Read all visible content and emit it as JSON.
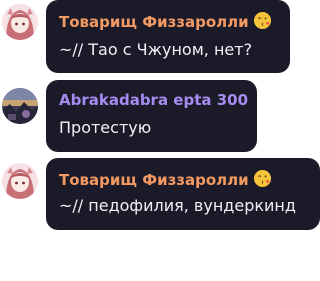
{
  "colors": {
    "bubble_bg": "#1b1a29",
    "message_text": "#f1f1f4"
  },
  "messages": [
    {
      "author": "Товарищ Физзаролли",
      "author_color": "#f39a63",
      "author_emoji": "kissing-face-heart-icon",
      "avatar": "anime-girl-avatar",
      "text": "~// Тао с Чжуном, нет?"
    },
    {
      "author": "Abrakadabra epta 300",
      "author_color": "#a48cf0",
      "author_emoji": "",
      "avatar": "dark-scene-avatar",
      "text": "Протестую"
    },
    {
      "author": "Товарищ Физзаролли",
      "author_color": "#f39a63",
      "author_emoji": "kissing-face-heart-icon",
      "avatar": "anime-girl-avatar",
      "text": "~// педофилия, вундеркинд"
    }
  ]
}
